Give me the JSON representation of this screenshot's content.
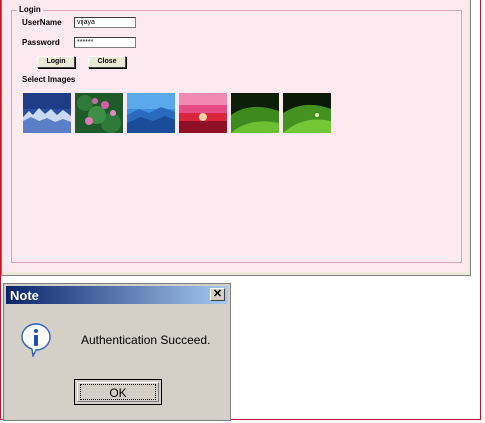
{
  "login_window": {
    "group_title": "Login",
    "username_label": "UserName",
    "username_value": "vijaya",
    "password_label": "Password",
    "password_value": "******",
    "login_button": "Login",
    "close_button": "Close",
    "images_label": "Select Images",
    "thumbnails": [
      "blue-icy-landscape",
      "pink-flowers-green-leaves",
      "blue-mountains",
      "red-sunset",
      "green-leaf",
      "green-leaf-dewdrop"
    ]
  },
  "dialog": {
    "title": "Note",
    "close_glyph": "✕",
    "message": "Authentication Succeed.",
    "ok_label": "OK",
    "icon": "info-icon"
  }
}
